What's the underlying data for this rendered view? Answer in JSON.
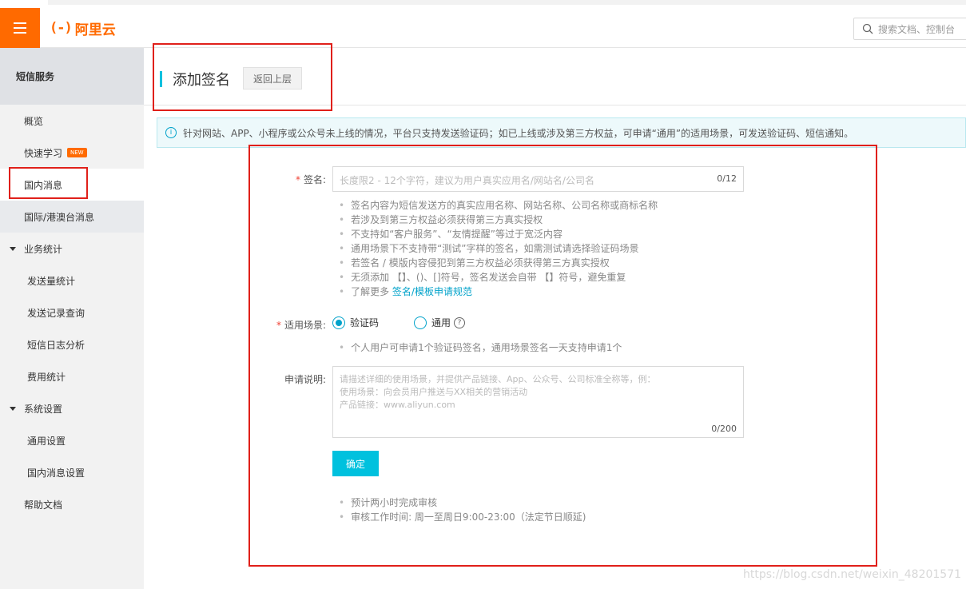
{
  "header": {
    "logo_mark": "(-)",
    "logo_text": "阿里云",
    "search_placeholder": "搜索文档、控制台"
  },
  "sidebar": {
    "title": "短信服务",
    "items": [
      {
        "label": "概览"
      },
      {
        "label": "快速学习",
        "badge": "NEW"
      },
      {
        "label": "国内消息"
      },
      {
        "label": "国际/港澳台消息"
      },
      {
        "label": "业务统计"
      },
      {
        "label": "发送量统计"
      },
      {
        "label": "发送记录查询"
      },
      {
        "label": "短信日志分析"
      },
      {
        "label": "费用统计"
      },
      {
        "label": "系统设置"
      },
      {
        "label": "通用设置"
      },
      {
        "label": "国内消息设置"
      },
      {
        "label": "帮助文档"
      }
    ]
  },
  "page": {
    "title": "添加签名",
    "back_label": "返回上层"
  },
  "notice": "针对网站、APP、小程序或公众号未上线的情况，平台只支持发送验证码；如已上线或涉及第三方权益，可申请“通用”的适用场景，可发送验证码、短信通知。",
  "form": {
    "signature": {
      "required_mark": "*",
      "label": "签名:",
      "placeholder": "长度限2 - 12个字符，建议为用户真实应用名/网站名/公司名",
      "counter": "0/12",
      "hints": [
        "签名内容为短信发送方的真实应用名称、网站名称、公司名称或商标名称",
        "若涉及到第三方权益必须获得第三方真实授权",
        "不支持如“客户服务”、“友情提醒”等过于宽泛内容",
        "通用场景下不支持带“测试”字样的签名，如需测试请选择验证码场景",
        "若签名 / 模版内容侵犯到第三方权益必须获得第三方真实授权",
        "无须添加 【】、()、[]符号，签名发送会自带 【】符号，避免重复"
      ],
      "learn_more_prefix": "了解更多 ",
      "learn_more_link": "签名/模板申请规范"
    },
    "scene": {
      "required_mark": "*",
      "label": "适用场景:",
      "options": [
        {
          "label": "验证码",
          "selected": true
        },
        {
          "label": "通用",
          "selected": false
        }
      ],
      "help_icon": "?",
      "hint": "个人用户可申请1个验证码签名，通用场景签名一天支持申请1个"
    },
    "description": {
      "label": "申请说明:",
      "placeholder": "请描述详细的使用场景，并提供产品链接、App、公众号、公司标准全称等，例：\n使用场景：向会员用户推送与XX相关的营销活动\n产品链接：www.aliyun.com",
      "counter": "0/200"
    },
    "submit_label": "确定",
    "footer_hints": [
      "预计两小时完成审核",
      "审核工作时间: 周一至周日9:00-23:00（法定节日顺延)"
    ]
  },
  "watermark": "https://blog.csdn.net/weixin_48201571",
  "colors": {
    "brand": "#ff6a00",
    "accent": "#00c1de",
    "annotation": "#e0201a"
  }
}
